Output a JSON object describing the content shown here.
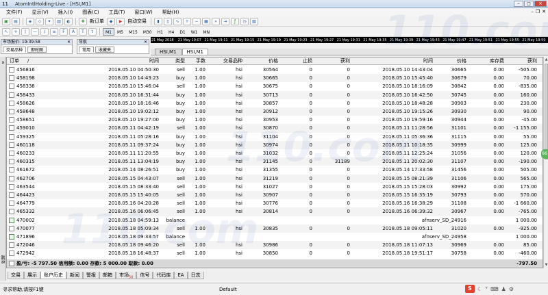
{
  "window": {
    "app_number": "11",
    "title": "AtomIntlHolding-Live - [HSI,M1]"
  },
  "menu": [
    "文件(F)",
    "显示(V)",
    "插入(I)",
    "图表(C)",
    "工具(T)",
    "窗口(W)",
    "帮助(H)"
  ],
  "toolbar": {
    "new_order": "新订单",
    "auto_trade": "自动交易",
    "timeframes": [
      "M1",
      "M5",
      "M15",
      "M30",
      "H1",
      "H4",
      "D1",
      "W1",
      "MN"
    ],
    "selected_timeframe": "M1"
  },
  "time_strip": [
    "21 May 2018",
    "21 May 19:07",
    "21 May 19:11",
    "21 May 19:15",
    "21 May 19:19",
    "21 May 19:23",
    "21 May 19:27",
    "21 May 19:31",
    "21 May 19:35",
    "21 May 19:39",
    "21 May 19:43",
    "21 May 19:47",
    "21 May 19:51",
    "21 May 19:55",
    "21 May 19:59"
  ],
  "market_watch": {
    "title": "市场报价: 19:39:58",
    "tabs": [
      "交易品种",
      "即时图"
    ]
  },
  "navigator": {
    "title": "导航",
    "tabs": [
      "常用",
      "收藏夹"
    ]
  },
  "chart_tabs": [
    "HSI,M1",
    "HSI,M1"
  ],
  "columns": {
    "order": "订单",
    "time": "时间",
    "type": "类型",
    "lots": "手数",
    "symbol": "交易品种",
    "price": "价格",
    "sl": "止损",
    "tp": "获利",
    "close_time": "时间",
    "close_price": "价格",
    "swap": "库存费",
    "profit": "获利"
  },
  "rows": [
    {
      "order": "456816",
      "time": "2018.05.10 04:50:30",
      "type": "sell",
      "lots": "1.00",
      "symbol": "hsi",
      "price": "30564",
      "sl": "0",
      "tp": "0",
      "ctime": "2018.05.10 14:43:04",
      "cprice": "30665",
      "swap": "0.00",
      "profit": "-505.00"
    },
    {
      "order": "458198",
      "time": "2018.05.10 14:43:23",
      "type": "buy",
      "lots": "1.00",
      "symbol": "hsi",
      "price": "30665",
      "sl": "0",
      "tp": "0",
      "ctime": "2018.05.10 15:45:40",
      "cprice": "30679",
      "swap": "0.00",
      "profit": "70.00"
    },
    {
      "order": "458338",
      "time": "2018.05.10 15:46:04",
      "type": "sell",
      "lots": "1.00",
      "symbol": "hsi",
      "price": "30675",
      "sl": "0",
      "tp": "0",
      "ctime": "2018.05.10 18:16:09",
      "cprice": "30842",
      "swap": "0.00",
      "profit": "-835.00"
    },
    {
      "order": "458433",
      "time": "2018.05.10 16:31:44",
      "type": "buy",
      "lots": "1.00",
      "symbol": "hsi",
      "price": "30713",
      "sl": "0",
      "tp": "0",
      "ctime": "2018.05.10 16:42:50",
      "cprice": "30745",
      "swap": "0.00",
      "profit": "160.00"
    },
    {
      "order": "458626",
      "time": "2018.05.10 18:16:46",
      "type": "buy",
      "lots": "1.00",
      "symbol": "hsi",
      "price": "30857",
      "sl": "0",
      "tp": "0",
      "ctime": "2018.05.10 18:48:28",
      "cprice": "30903",
      "swap": "0.00",
      "profit": "230.00"
    },
    {
      "order": "458648",
      "time": "2018.05.10 19:02:12",
      "type": "buy",
      "lots": "1.00",
      "symbol": "hsi",
      "price": "30912",
      "sl": "0",
      "tp": "0",
      "ctime": "2018.05.10 19:15:26",
      "cprice": "30930",
      "swap": "0.00",
      "profit": "90.00"
    },
    {
      "order": "458651",
      "time": "2018.05.10 19:27:00",
      "type": "buy",
      "lots": "1.00",
      "symbol": "hsi",
      "price": "30953",
      "sl": "0",
      "tp": "0",
      "ctime": "2018.05.10 19:59:16",
      "cprice": "30944",
      "swap": "0.00",
      "profit": "-45.00"
    },
    {
      "order": "459010",
      "time": "2018.05.11 04:42:19",
      "type": "sell",
      "lots": "1.00",
      "symbol": "hsi",
      "price": "30870",
      "sl": "0",
      "tp": "0",
      "ctime": "2018.05.11 11:28:56",
      "cprice": "31101",
      "swap": "0.00",
      "profit": "-1 155.00"
    },
    {
      "order": "459325",
      "time": "2018.05.11 05:28:16",
      "type": "buy",
      "lots": "1.00",
      "symbol": "hsi",
      "price": "31104",
      "sl": "0",
      "tp": "0",
      "ctime": "2018.05.11 05:36:36",
      "cprice": "31115",
      "swap": "0.00",
      "profit": "55.00"
    },
    {
      "order": "460118",
      "time": "2018.05.11 09:37:24",
      "type": "buy",
      "lots": "1.00",
      "symbol": "hsi",
      "price": "30974",
      "sl": "0",
      "tp": "0",
      "ctime": "2018.05.11 10:18:35",
      "cprice": "30999",
      "swap": "0.00",
      "profit": "125.00"
    },
    {
      "order": "460233",
      "time": "2018.05.11 11:20:55",
      "type": "buy",
      "lots": "1.00",
      "symbol": "hsi",
      "price": "31032",
      "sl": "0",
      "tp": "0",
      "ctime": "2018.05.11 12:25:24",
      "cprice": "31056",
      "swap": "0.00",
      "profit": "120.00"
    },
    {
      "order": "460315",
      "time": "2018.05.11 13:04:19",
      "type": "buy",
      "lots": "1.00",
      "symbol": "hsi",
      "price": "31145",
      "sl": "0",
      "tp": "31189",
      "ctime": "2018.05.11 20:02:30",
      "cprice": "31107",
      "swap": "0.00",
      "profit": "-190.00"
    },
    {
      "order": "461672",
      "time": "2018.05.14 08:26:51",
      "type": "buy",
      "lots": "1.00",
      "symbol": "hsi",
      "price": "31355",
      "sl": "0",
      "tp": "0",
      "ctime": "2018.05.14 17:33:58",
      "cprice": "31456",
      "swap": "0.00",
      "profit": "505.00"
    },
    {
      "order": "462706",
      "time": "2018.05.15 04:43:07",
      "type": "sell",
      "lots": "1.00",
      "symbol": "hsi",
      "price": "31219",
      "sl": "0",
      "tp": "0",
      "ctime": "2018.05.15 08:21:39",
      "cprice": "31106",
      "swap": "0.00",
      "profit": "565.00"
    },
    {
      "order": "463544",
      "time": "2018.05.15 08:33:40",
      "type": "sell",
      "lots": "1.00",
      "symbol": "hsi",
      "price": "31027",
      "sl": "0",
      "tp": "0",
      "ctime": "2018.05.15 15:28:03",
      "cprice": "30992",
      "swap": "0.00",
      "profit": "175.00"
    },
    {
      "order": "464423",
      "time": "2018.05.15 15:40:05",
      "type": "sell",
      "lots": "1.00",
      "symbol": "hsi",
      "price": "30907",
      "sl": "0",
      "tp": "0",
      "ctime": "2018.05.15 16:35:19",
      "cprice": "30793",
      "swap": "0.00",
      "profit": "570.00"
    },
    {
      "order": "464779",
      "time": "2018.05.16 04:20:28",
      "type": "sell",
      "lots": "1.00",
      "symbol": "hsi",
      "price": "30776",
      "sl": "0",
      "tp": "0",
      "ctime": "2018.05.16 16:38:29",
      "cprice": "31108",
      "swap": "0.00",
      "profit": "-1 660.00"
    },
    {
      "order": "465332",
      "time": "2018.05.16 06:06:45",
      "type": "sell",
      "lots": "1.00",
      "symbol": "hsi",
      "price": "30814",
      "sl": "0",
      "tp": "0",
      "ctime": "2018.05.16 06:39:32",
      "cprice": "30967",
      "swap": "0.00",
      "profit": "-765.00"
    },
    {
      "order": "470002",
      "time": "2018.05.18 04:59:13",
      "type": "balance",
      "lots": "",
      "symbol": "",
      "price": "",
      "sl": "",
      "tp": "",
      "ctime": "",
      "cprice": "afnserv_SD_24916",
      "swap": "",
      "profit": "1 000.00"
    },
    {
      "order": "470077",
      "time": "2018.05.18 05:09:34",
      "type": "sell",
      "lots": "1.00",
      "symbol": "hsi",
      "price": "30835",
      "sl": "0",
      "tp": "0",
      "ctime": "2018.05.18 09:05:11",
      "cprice": "31020",
      "swap": "0.00",
      "profit": "-925.00"
    },
    {
      "order": "471896",
      "time": "2018.05.18 09:33:57",
      "type": "balance",
      "lots": "",
      "symbol": "",
      "price": "",
      "sl": "",
      "tp": "",
      "ctime": "",
      "cprice": "afnserv_SD_24958",
      "swap": "",
      "profit": "1 000.00"
    },
    {
      "order": "472046",
      "time": "2018.05.18 09:46:20",
      "type": "sell",
      "lots": "1.00",
      "symbol": "hsi",
      "price": "30986",
      "sl": "0",
      "tp": "0",
      "ctime": "2018.05.18 11:07:13",
      "cprice": "30969",
      "swap": "0.00",
      "profit": "85.00"
    },
    {
      "order": "472942",
      "time": "2018.05.18 16:48:37",
      "type": "sell",
      "lots": "1.00",
      "symbol": "hsi",
      "price": "30850",
      "sl": "0",
      "tp": "0",
      "ctime": "2018.05.18 19:51:17",
      "cprice": "30758",
      "swap": "0.00",
      "profit": "-460.00"
    }
  ],
  "footer": {
    "summary": "盈/亏: -5 797.50  信用额: 0.00  存款: 5 000.00  取款: 0.00",
    "total": "-797.50"
  },
  "terminal_side_label": "终端",
  "terminal_tabs": [
    {
      "label": "交易",
      "badge": ""
    },
    {
      "label": "展示",
      "badge": ""
    },
    {
      "label": "账户历史",
      "badge": ""
    },
    {
      "label": "新闻",
      "badge": ""
    },
    {
      "label": "警报",
      "badge": ""
    },
    {
      "label": "邮箱",
      "badge": ""
    },
    {
      "label": "市场",
      "badge": "50"
    },
    {
      "label": "信号",
      "badge": ""
    },
    {
      "label": "代码库",
      "badge": ""
    },
    {
      "label": "EA",
      "badge": ""
    },
    {
      "label": "日志",
      "badge": ""
    }
  ],
  "status": {
    "help": "寻求帮助,请按F1键",
    "profile": "Default"
  },
  "side_button": "66",
  "watermark": "110.com"
}
